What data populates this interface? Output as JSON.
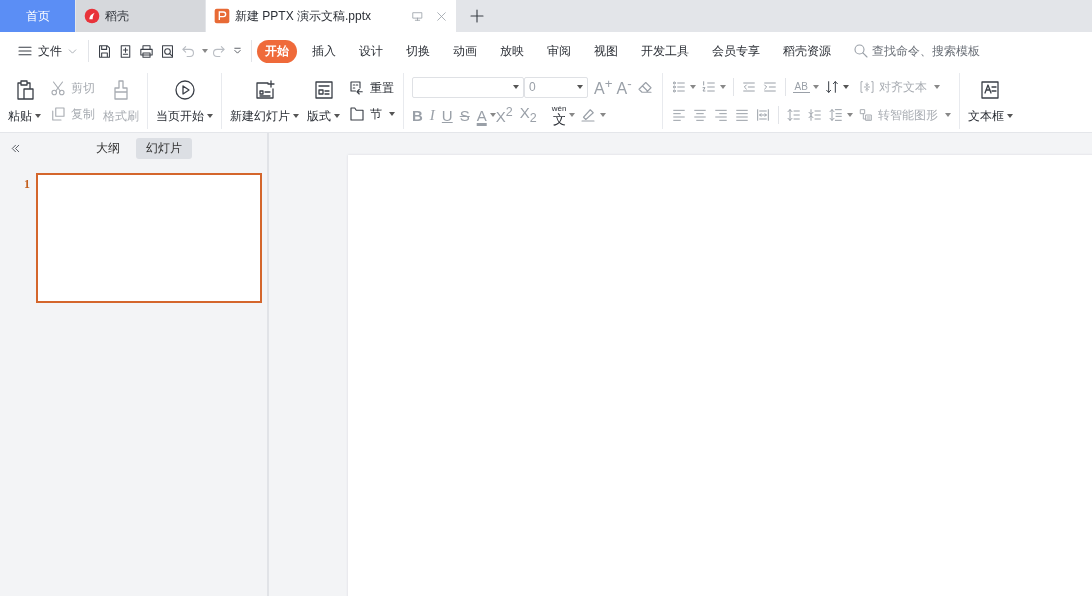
{
  "tabs": [
    {
      "label": "首页",
      "kind": "home",
      "selected": false
    },
    {
      "label": "稻壳",
      "kind": "docer",
      "selected": false
    },
    {
      "label": "新建 PPTX 演示文稿.pptx",
      "kind": "document",
      "selected": true
    }
  ],
  "menu": {
    "file": "文件",
    "ribbon_tabs": [
      {
        "label": "开始",
        "selected": true
      },
      {
        "label": "插入",
        "selected": false
      },
      {
        "label": "设计",
        "selected": false
      },
      {
        "label": "切换",
        "selected": false
      },
      {
        "label": "动画",
        "selected": false
      },
      {
        "label": "放映",
        "selected": false
      },
      {
        "label": "审阅",
        "selected": false
      },
      {
        "label": "视图",
        "selected": false
      },
      {
        "label": "开发工具",
        "selected": false
      },
      {
        "label": "会员专享",
        "selected": false
      },
      {
        "label": "稻壳资源",
        "selected": false
      }
    ],
    "search": {
      "placeholder": "查找命令、搜索模板"
    }
  },
  "ribbon": {
    "paste": {
      "label": "粘贴",
      "disabled": false
    },
    "cut": {
      "label": "剪切",
      "disabled": true
    },
    "copy": {
      "label": "复制",
      "disabled": true
    },
    "format_painter": {
      "label": "格式刷",
      "disabled": true
    },
    "play_from_current": {
      "label": "当页开始",
      "disabled": false
    },
    "new_slide": {
      "label": "新建幻灯片",
      "disabled": false
    },
    "layout": {
      "label": "版式",
      "disabled": false
    },
    "reset": {
      "label": "重置",
      "disabled": false
    },
    "section": {
      "label": "节",
      "disabled": false
    },
    "font_size": {
      "value": "0"
    },
    "font_marks": [
      {
        "text": "A$^{+}$"
      },
      {
        "text": "A$^{-}$"
      }
    ],
    "format_buttons": [
      {
        "kind": "bold",
        "text": "B"
      },
      {
        "kind": "italic",
        "text": "I"
      },
      {
        "kind": "underline",
        "text": "U"
      },
      {
        "kind": "strike",
        "text": "S"
      },
      {
        "kind": "color",
        "text": "A"
      },
      {
        "kind": "superscript",
        "text": "X$^{2}$"
      },
      {
        "kind": "subscript",
        "text": "X$_{2}$"
      }
    ],
    "pinyin": {
      "ruby": "wén",
      "char": "文"
    },
    "char_spacing": {
      "text": "AB"
    },
    "align_text": {
      "label": "对齐文本",
      "disabled": true
    },
    "smart_art": {
      "label": "转智能图形",
      "disabled": true
    },
    "text_box": {
      "label": "文本框",
      "disabled": false
    }
  },
  "panel": {
    "views": [
      {
        "label": "大纲",
        "selected": false
      },
      {
        "label": "幻灯片",
        "selected": true
      }
    ],
    "slides": [
      {
        "number": "1",
        "selected": true
      }
    ]
  }
}
